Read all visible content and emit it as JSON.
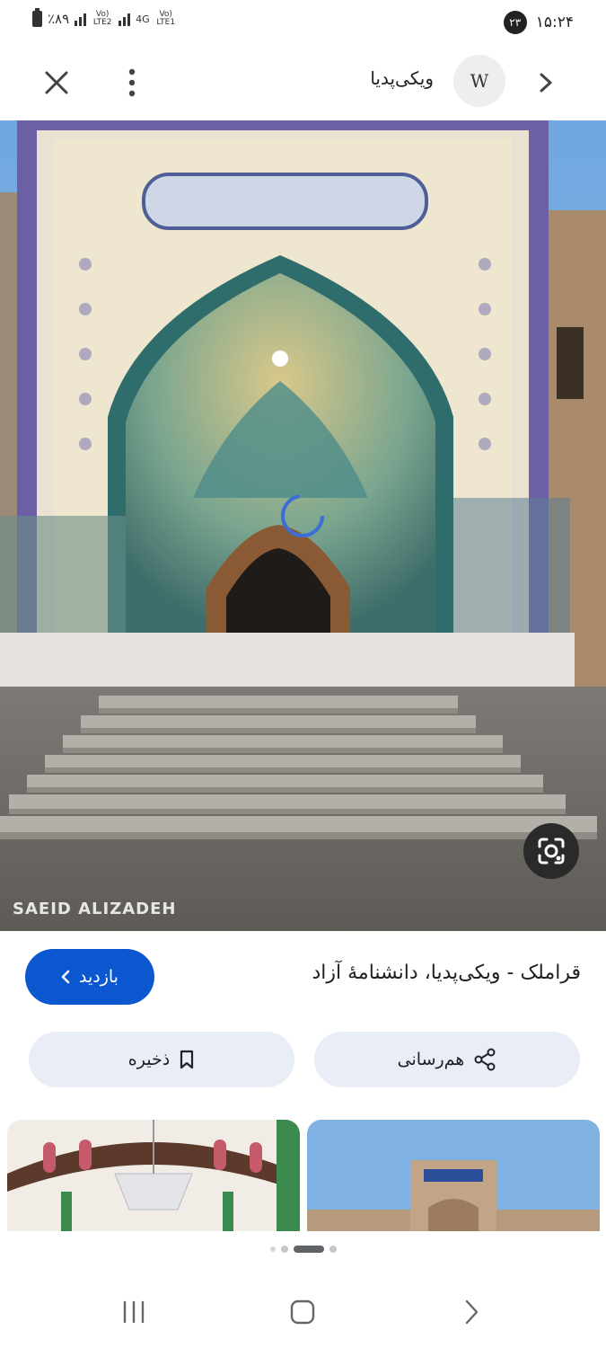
{
  "status_bar": {
    "battery": "٪۸۹",
    "sim1": "Vo) LTE2",
    "sim2_tech": "4G",
    "sim2": "Vo) LTE1",
    "notification_count": "۲۳",
    "time": "۱۵:۲۴"
  },
  "top_bar": {
    "title": "ویکی‌پدیا",
    "logo_letter": "W"
  },
  "image": {
    "watermark": "SAEID ALIZADEH"
  },
  "result": {
    "title": "قراملک - ویکی‌پدیا، دانشنامهٔ آزاد",
    "visit_label": "بازدید"
  },
  "actions": {
    "save_label": "ذخیره",
    "share_label": "هم‌رسانی"
  },
  "carousel": {
    "total_dots": 5,
    "active_index": 3
  },
  "colors": {
    "primary": "#0b57d0",
    "pill_bg": "#e9eef6"
  }
}
